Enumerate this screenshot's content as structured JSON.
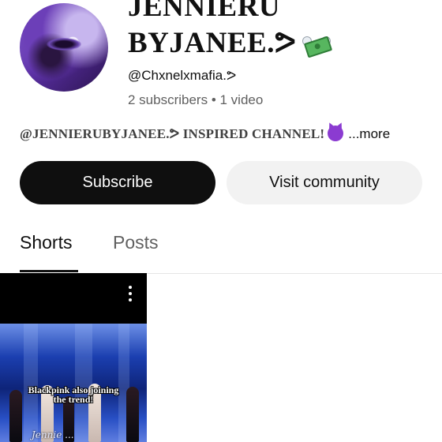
{
  "channel": {
    "title_line1": "JENNIERU",
    "title_line2": "BYJANEE.ᕗ",
    "title_icon": "money-with-wings-icon",
    "handle": "@Chxnelxmafia.ᕗ",
    "stats": "2 subscribers • 1 video",
    "description": "@JENNIERUBYJANEE.ᕗ INSPIRED CHANNEL!",
    "description_icon": "smiling-devil-icon",
    "more_label": "...more"
  },
  "buttons": {
    "subscribe": "Subscribe",
    "visit_community": "Visit community"
  },
  "tabs": [
    {
      "label": "Shorts",
      "active": true
    },
    {
      "label": "Posts",
      "active": false
    }
  ],
  "shorts": [
    {
      "caption_line1": "Blackpink also joining",
      "caption_line2": "the trend!",
      "watermark": "Jennie ..."
    }
  ],
  "colors": {
    "subscribe_bg": "#0f0f0f",
    "community_bg": "#f2f2f2",
    "secondary_text": "#606060"
  }
}
